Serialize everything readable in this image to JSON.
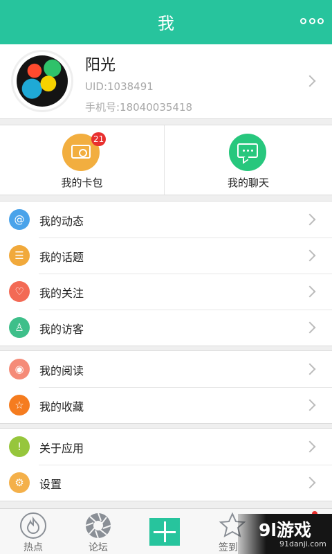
{
  "header": {
    "title": "我"
  },
  "profile": {
    "name": "阳光",
    "uid": "UID:1038491",
    "phone": "手机号:18040035418"
  },
  "quick": [
    {
      "label": "我的卡包",
      "badge": "21",
      "color": "#f2ae3f",
      "icon": "wallet-icon"
    },
    {
      "label": "我的聊天",
      "color": "#27c77d",
      "icon": "chat-icon"
    }
  ],
  "menu1": [
    {
      "label": "我的动态",
      "icon": "at-icon",
      "glyph": "@",
      "color": "#4aa3ea"
    },
    {
      "label": "我的话题",
      "icon": "document-icon",
      "glyph": "☰",
      "color": "#f1a93b"
    },
    {
      "label": "我的关注",
      "icon": "heart-icon",
      "glyph": "♡",
      "color": "#f36a55"
    },
    {
      "label": "我的访客",
      "icon": "person-icon",
      "glyph": "♙",
      "color": "#3ebf8a"
    }
  ],
  "menu2": [
    {
      "label": "我的阅读",
      "icon": "eye-icon",
      "glyph": "◉",
      "color": "#f58b78"
    },
    {
      "label": "我的收藏",
      "icon": "star-icon",
      "glyph": "☆",
      "color": "#f57c1f"
    }
  ],
  "menu3": [
    {
      "label": "关于应用",
      "icon": "info-icon",
      "glyph": "!",
      "color": "#96c63c"
    },
    {
      "label": "设置",
      "icon": "gear-icon",
      "glyph": "⚙",
      "color": "#f4b04a"
    }
  ],
  "tabs": [
    {
      "label": "热点",
      "icon": "flame-icon"
    },
    {
      "label": "论坛",
      "icon": "aperture-icon"
    },
    {
      "label": "签到",
      "icon": "star-icon"
    }
  ],
  "watermark": {
    "logo": "9l游戏",
    "url": "91danji.com"
  }
}
